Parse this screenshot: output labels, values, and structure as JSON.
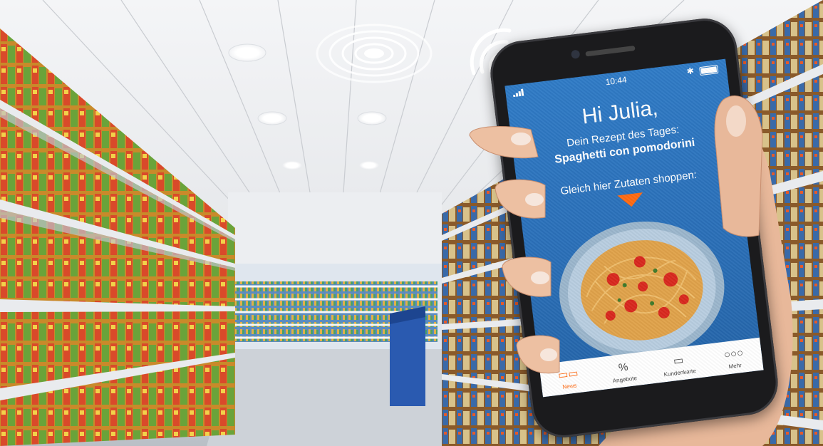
{
  "phone": {
    "status": {
      "time": "10:44",
      "signal_icon": "signal-bars-icon",
      "bluetooth_icon": "bluetooth-icon",
      "battery_icon": "battery-icon"
    },
    "greeting": "Hi Julia,",
    "subtitle": "Dein Rezept des Tages:",
    "recipe": "Spaghetti con pomodorini",
    "cta": "Gleich hier Zutaten shoppen:",
    "accent_color": "#ff6a12",
    "tabs": [
      {
        "label": "News",
        "icon": "news-icon",
        "active": true
      },
      {
        "label": "Angebote",
        "icon": "percent-icon",
        "active": false
      },
      {
        "label": "Kundenkarte",
        "icon": "card-icon",
        "active": false
      },
      {
        "label": "Mehr",
        "icon": "more-icon",
        "active": false
      }
    ]
  },
  "beacon": {
    "icon": "beacon-waves-icon"
  },
  "wifi": {
    "icon": "wireless-signal-icon"
  }
}
